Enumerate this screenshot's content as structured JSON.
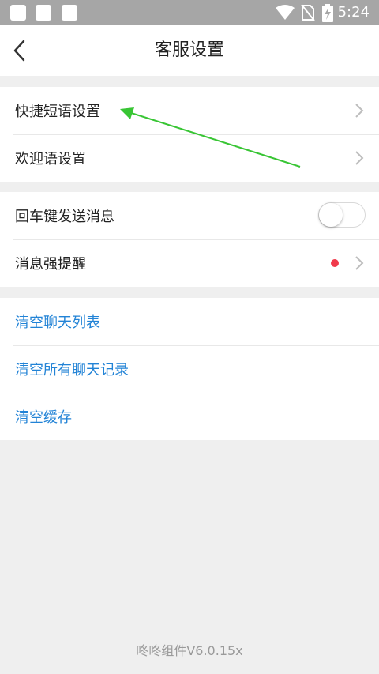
{
  "status_bar": {
    "time": "5:24",
    "icons": [
      "notification-square",
      "notification-square",
      "notification-square",
      "wifi-icon",
      "no-sim-icon",
      "battery-charging-icon"
    ],
    "background": "#a6a6a6"
  },
  "nav": {
    "title": "客服设置",
    "back_icon": "back-chevron-icon"
  },
  "groups": {
    "quick": [
      {
        "label": "快捷短语设置"
      },
      {
        "label": "欢迎语设置"
      }
    ],
    "messages": {
      "enter_send": {
        "label": "回车键发送消息",
        "enabled": false
      },
      "strong_reminder": {
        "label": "消息强提醒",
        "dot_color": "#f03a4b"
      }
    },
    "actions": [
      {
        "label": "清空聊天列表"
      },
      {
        "label": "清空所有聊天记录"
      },
      {
        "label": "清空缓存"
      }
    ]
  },
  "footer": {
    "version": "咚咚组件V6.0.15x"
  },
  "colors": {
    "link": "#2283d6",
    "page_bg": "#efefef",
    "annotation_arrow": "#38c534"
  }
}
